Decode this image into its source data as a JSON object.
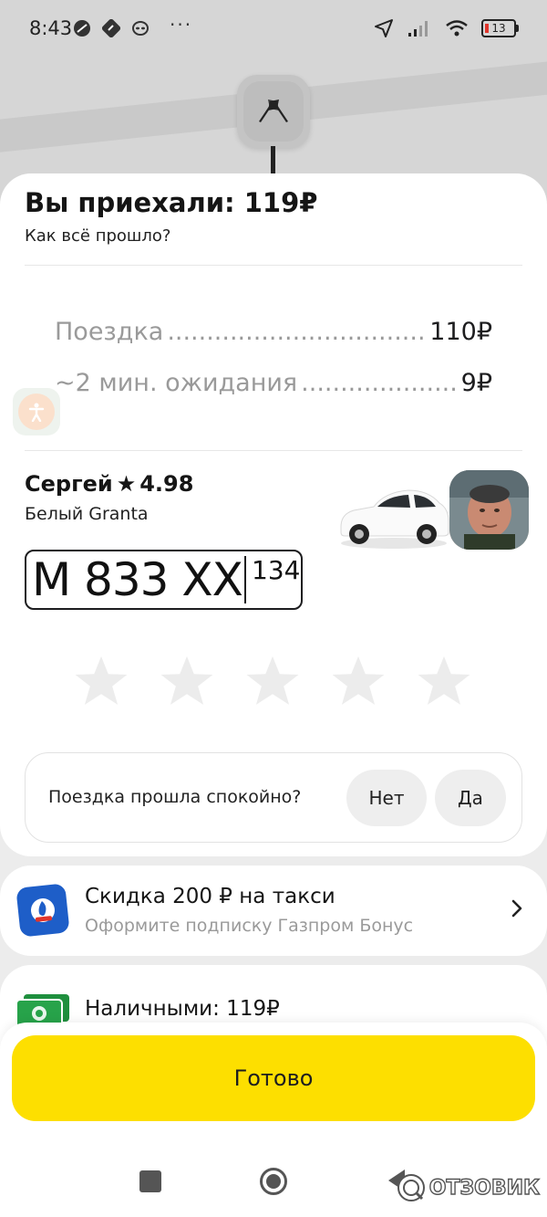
{
  "status_bar": {
    "time": "8:43",
    "more": "···",
    "battery": "13"
  },
  "map": {
    "pin_icon": "finish-flags-icon"
  },
  "trip": {
    "title": "Вы приехали: 119₽",
    "subtitle": "Как всё прошло?",
    "fare_items": [
      {
        "label": "Поездка",
        "amount": "110₽"
      },
      {
        "label": "~2 мин. ожидания",
        "amount": "9₽"
      }
    ]
  },
  "driver": {
    "name": "Сергей",
    "rating_star": "★",
    "rating": "4.98",
    "car": "Белый Granta",
    "plate_number": "М 833 ХХ",
    "plate_region": "134"
  },
  "rating": {
    "stars_total": 5,
    "stars_selected": 0
  },
  "calm_question": {
    "text": "Поездка прошла спокойно?",
    "no_label": "Нет",
    "yes_label": "Да"
  },
  "promo": {
    "title": "Скидка 200 ₽ на такси",
    "subtitle": "Оформите подписку Газпром Бонус"
  },
  "payment": {
    "text": "Наличными: 119₽"
  },
  "done_button": {
    "label": "Готово"
  },
  "watermark": {
    "text": "ОТЗОВИК"
  },
  "colors": {
    "accent_yellow": "#fddf00",
    "promo_blue": "#1e5ec8",
    "cash_green": "#27a34a"
  }
}
